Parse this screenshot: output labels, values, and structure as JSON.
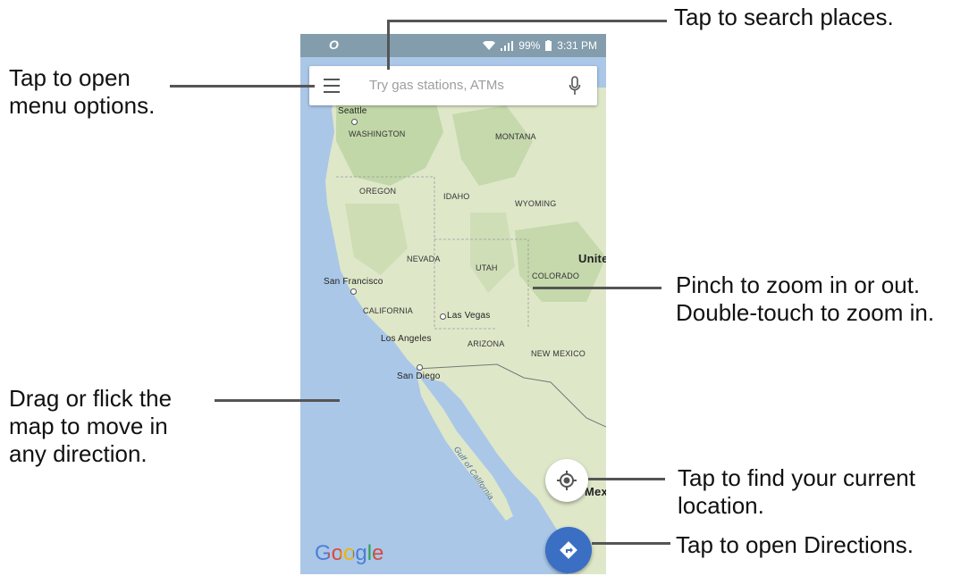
{
  "callouts": {
    "search": "Tap to search places.",
    "menu": "Tap to open\nmenu options.",
    "zoom": "Pinch to zoom in or out.\nDouble-touch to zoom in.",
    "drag": "Drag or flick the\nmap to move in\nany direction.",
    "location": "Tap to find your current\nlocation.",
    "directions": "Tap to open Directions."
  },
  "status_bar": {
    "left_icon": "O",
    "battery": "99%",
    "time": "3:31 PM"
  },
  "search_bar": {
    "placeholder": "Try gas stations, ATMs",
    "menu_icon": "hamburger-menu-icon",
    "mic_icon": "microphone-icon"
  },
  "map": {
    "labels": {
      "seattle": "Seattle",
      "washington": "WASHINGTON",
      "montana": "MONTANA",
      "oregon": "OREGON",
      "idaho": "IDAHO",
      "wyoming": "WYOMING",
      "nevada": "NEVADA",
      "utah": "UTAH",
      "united": "Unite",
      "colorado": "COLORADO",
      "san_francisco": "San Francisco",
      "california": "CALIFORNIA",
      "las_vegas": "Las Vegas",
      "los_angeles": "Los Angeles",
      "arizona": "ARIZONA",
      "new_mexico": "NEW MEXICO",
      "san_diego": "San Diego",
      "gulf": "Gulf of California",
      "mexico": "Mexi"
    },
    "logo": "Google"
  },
  "buttons": {
    "location_icon": "my-location-icon",
    "directions_icon": "directions-icon"
  },
  "colors": {
    "water": "#aac7e8",
    "land": "#dfe7c9",
    "green": "#b9d3a0",
    "directions_fab": "#3a6fc4"
  }
}
